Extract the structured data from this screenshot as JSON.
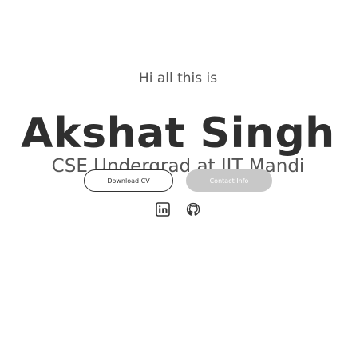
{
  "hero": {
    "greeting": "Hi all this is",
    "name": "Akshat Singh",
    "subtitle": "CSE Undergrad at IIT Mandi"
  },
  "buttons": {
    "download_cv": "Download CV",
    "contact_info": "Contact Info"
  },
  "socials": [
    {
      "icon": "linkedin-icon"
    },
    {
      "icon": "github-icon"
    }
  ],
  "colors": {
    "text": "#333333",
    "button_solid": "#c8c8c8",
    "background": "#ffffff"
  }
}
